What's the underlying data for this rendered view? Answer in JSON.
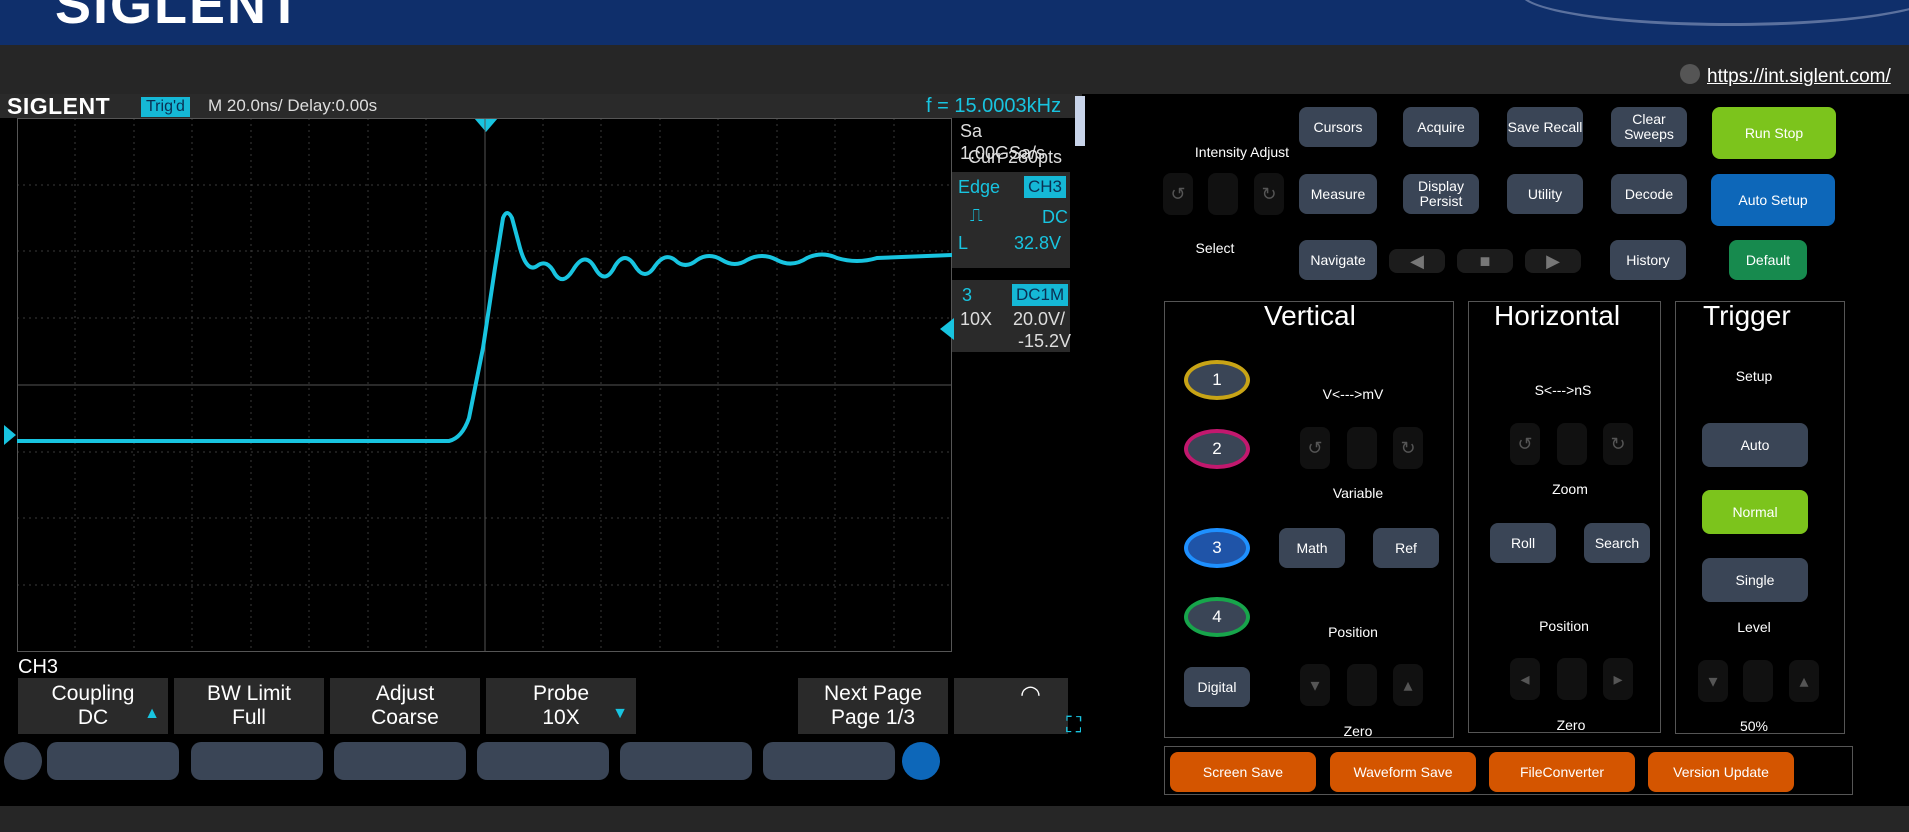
{
  "banner": {
    "logo_text": "SIGLENT"
  },
  "url": {
    "link": "https://int.siglent.com/"
  },
  "scope": {
    "brand": "SIGLENT",
    "trigger_status": "Trig'd",
    "timebase": "M 20.0ns/  Delay:0.00s",
    "frequency": "f = 15.0003kHz",
    "sample_rate": "Sa 1.00GSa/s",
    "memory": "Curr 280pts",
    "trigger": {
      "type": "Edge",
      "source": "CH3",
      "coupling": "DC",
      "level_label": "L",
      "level": "32.8V"
    },
    "channel": {
      "number": "3",
      "impedance": "DC1M",
      "probe": "10X",
      "scale": "20.0V/",
      "offset": "-15.2V",
      "waveform_color": "#18c4e0"
    },
    "channel_menu_label": "CH3",
    "softkeys": [
      {
        "line1": "Coupling",
        "line2": "DC"
      },
      {
        "line1": "BW Limit",
        "line2": "Full"
      },
      {
        "line1": "Adjust",
        "line2": "Coarse"
      },
      {
        "line1": "Probe",
        "line2": "10X"
      },
      {
        "line1": "Next Page",
        "line2": "Page 1/3"
      }
    ]
  },
  "controls": {
    "intensity_label": "Intensity Adjust",
    "select_label": "Select",
    "top_buttons": {
      "cursors": "Cursors",
      "acquire": "Acquire",
      "save_recall": "Save Recall",
      "clear_sweeps": "Clear Sweeps",
      "run_stop": "Run Stop",
      "measure": "Measure",
      "display_persist": "Display Persist",
      "utility": "Utility",
      "decode": "Decode",
      "auto_setup": "Auto Setup",
      "navigate": "Navigate",
      "history": "History",
      "default": "Default"
    },
    "vertical": {
      "title": "Vertical",
      "scale_label": "V<--->mV",
      "variable_label": "Variable",
      "position_label": "Position",
      "zero_label": "Zero",
      "channels": [
        "1",
        "2",
        "3",
        "4"
      ],
      "channel_colors": [
        "#c8a416",
        "#c2186e",
        "#1e90ff",
        "#17a54b"
      ],
      "math": "Math",
      "ref": "Ref",
      "digital": "Digital"
    },
    "horizontal": {
      "title": "Horizontal",
      "scale_label": "S<--->nS",
      "zoom_label": "Zoom",
      "position_label": "Position",
      "zero_label": "Zero",
      "roll": "Roll",
      "search": "Search"
    },
    "trigger": {
      "title": "Trigger",
      "setup_label": "Setup",
      "auto": "Auto",
      "normal": "Normal",
      "single": "Single",
      "level_label": "Level",
      "level_value": "50%"
    },
    "bottom_buttons": {
      "screen_save": "Screen Save",
      "waveform_save": "Waveform Save",
      "file_converter": "FileConverter",
      "version_update": "Version Update"
    }
  }
}
